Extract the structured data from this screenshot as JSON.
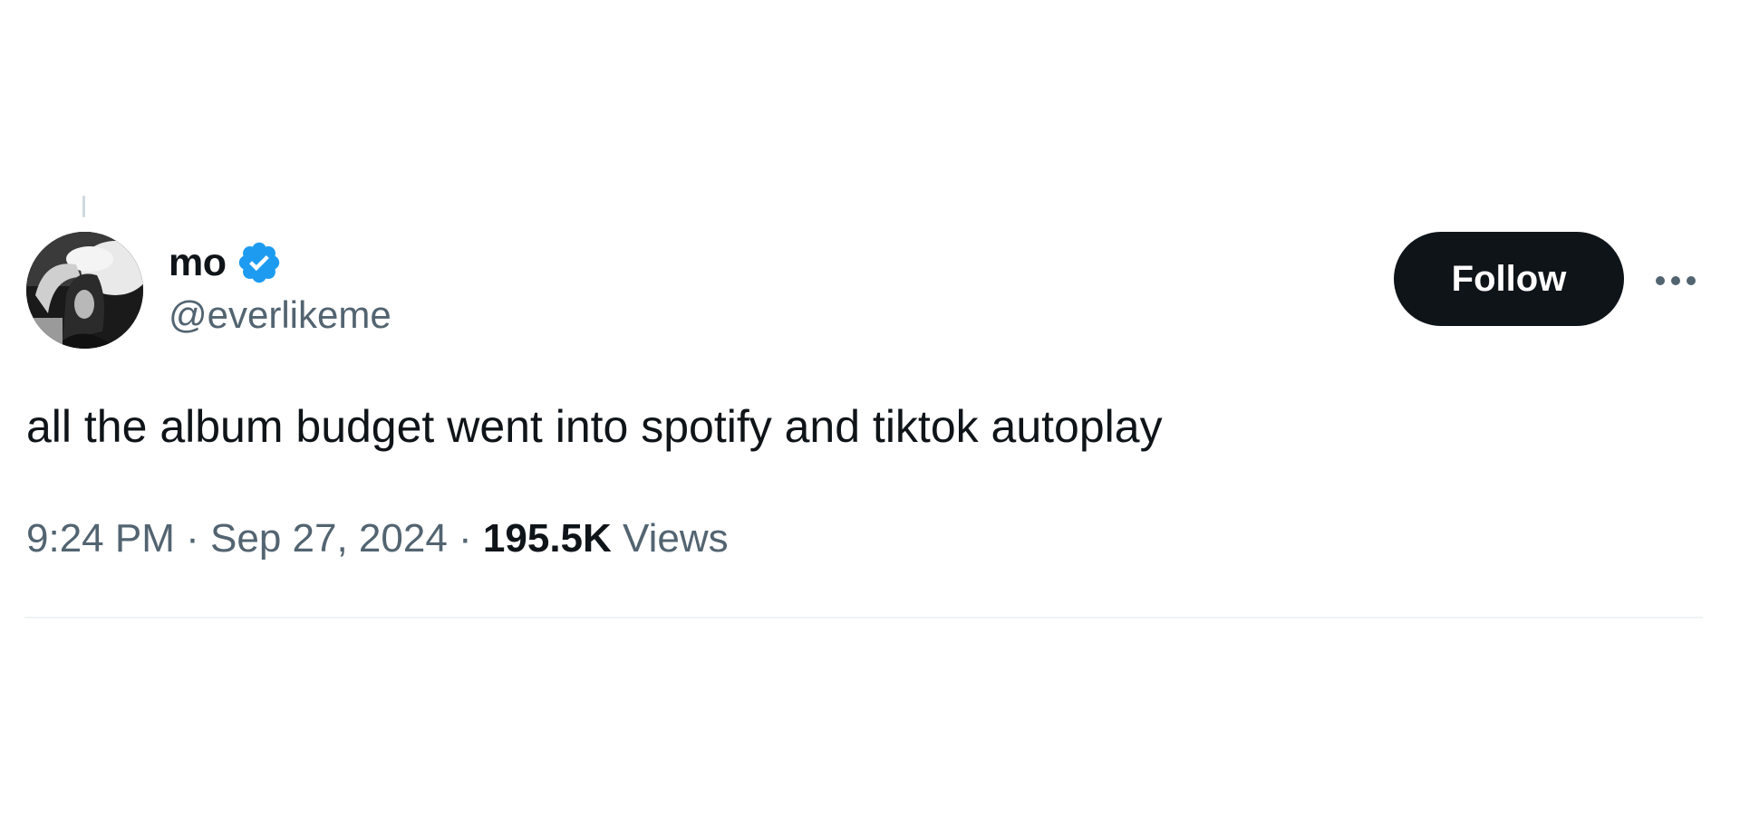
{
  "author": {
    "display_name": "mo",
    "handle": "@everlikeme",
    "verified": true,
    "verified_icon": "verified-badge-icon",
    "avatar": "profile-avatar"
  },
  "actions": {
    "follow_label": "Follow",
    "more_icon": "more-horizontal-icon"
  },
  "tweet": {
    "text": "all the album budget went into spotify and tiktok autoplay",
    "time": "9:24 PM",
    "separator": "·",
    "date": "Sep 27, 2024",
    "views_count": "195.5K",
    "views_label": "Views"
  },
  "colors": {
    "text_primary": "#0f1419",
    "text_secondary": "#536471",
    "verified_blue": "#1d9bf0",
    "button_bg": "#0f1419",
    "divider": "#eff3f4"
  }
}
